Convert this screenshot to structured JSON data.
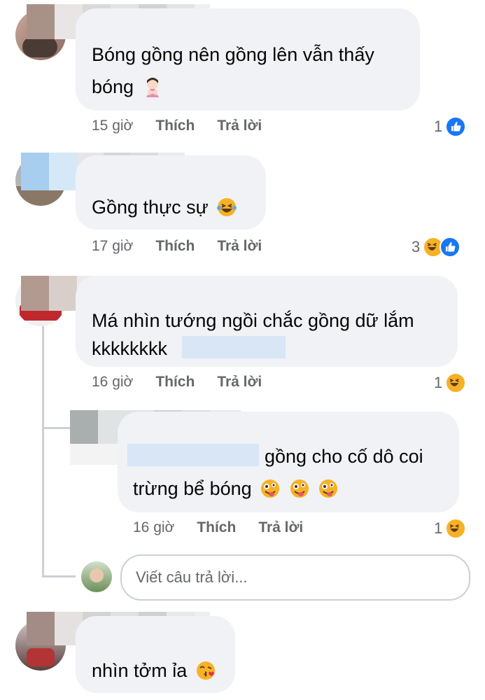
{
  "colors": {
    "bubble": "#f0f2f5",
    "meta": "#65676b",
    "like": "#1877f2",
    "haha": "#f7b125"
  },
  "comments": [
    {
      "text_line1": "Bóng gồng nên gồng lên vẫn thấy",
      "text_line2": "bóng",
      "emoji": "person-gesturing-no-emoji",
      "time": "15 giờ",
      "like": "Thích",
      "reply": "Trả lời",
      "reaction_count": "1",
      "reaction_icon": "like-icon"
    },
    {
      "text_line1": "Gồng thực sự",
      "emoji": "laughing-tears-emoji",
      "time": "17 giờ",
      "like": "Thích",
      "reply": "Trả lời",
      "reaction_count": "3",
      "reaction_icon": "haha-and-like-icons"
    },
    {
      "text_line1": "Má nhìn tướng ngồi chắc gồng dữ lắm",
      "text_line2": "kkkkkkkk",
      "time": "16 giờ",
      "like": "Thích",
      "reply": "Trả lời",
      "reaction_count": "1",
      "reaction_icon": "haha-icon"
    },
    {
      "text_line1": "gồng cho cố dô coi",
      "text_line2": "trừng bể bóng",
      "emoji": "zany-face-emoji x3",
      "time": "16 giờ",
      "like": "Thích",
      "reply": "Trả lời",
      "reaction_count": "1",
      "reaction_icon": "haha-icon"
    },
    {
      "text_line1": "nhìn tởm ỉa",
      "emoji": "kissing-heart-emoji"
    }
  ],
  "reply_box": {
    "placeholder": "Viết câu trả lời..."
  }
}
